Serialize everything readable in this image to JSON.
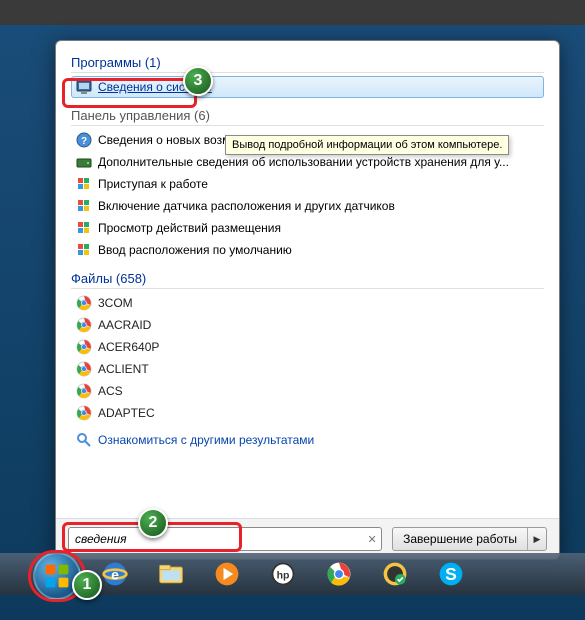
{
  "sections": {
    "programs": {
      "header": "Программы (1)"
    },
    "control_panel": {
      "header": "Панель управления (6)"
    },
    "files": {
      "header": "Файлы (658)"
    }
  },
  "programs": [
    {
      "label": "Сведения о системе",
      "icon": "system-info"
    }
  ],
  "control_panel": [
    {
      "label": "Сведения о новых возможностях Windows 7 в Интернете",
      "icon": "help"
    },
    {
      "label": "Дополнительные сведения об использовании устройств хранения для у...",
      "icon": "drive"
    },
    {
      "label": "Приступая к работе",
      "icon": "flag"
    },
    {
      "label": "Включение датчика расположения и других датчиков",
      "icon": "flag"
    },
    {
      "label": "Просмотр действий размещения",
      "icon": "flag"
    },
    {
      "label": "Ввод расположения по умолчанию",
      "icon": "flag"
    }
  ],
  "files": [
    {
      "label": "3COM"
    },
    {
      "label": "AACRAID"
    },
    {
      "label": "ACER640P"
    },
    {
      "label": "ACLIENT"
    },
    {
      "label": "ACS"
    },
    {
      "label": "ADAPTEC"
    }
  ],
  "more_results": "Ознакомиться с другими результатами",
  "search": {
    "value": "сведения"
  },
  "shutdown": {
    "label": "Завершение работы"
  },
  "tooltip": "Вывод подробной информации об этом компьютере.",
  "badges": {
    "b1": "1",
    "b2": "2",
    "b3": "3"
  }
}
